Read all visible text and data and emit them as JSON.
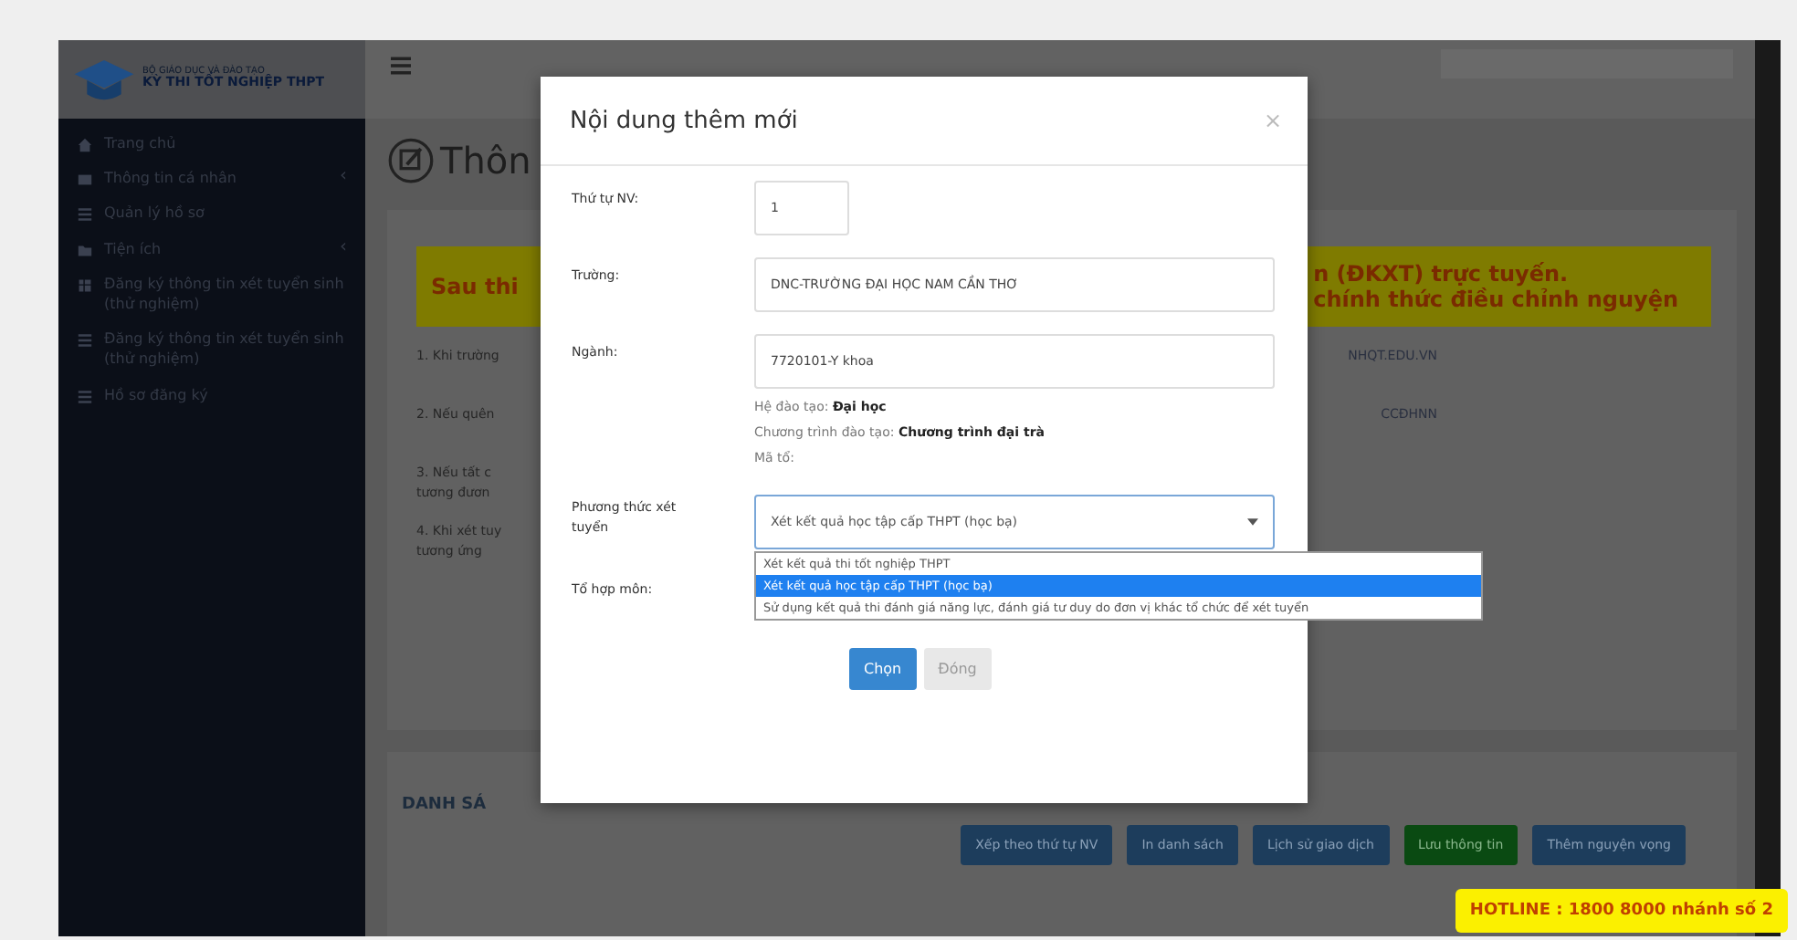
{
  "logo": {
    "line_1": "BỘ GIÁO DỤC VÀ ĐÀO TẠO",
    "line_2": "KỲ THI TỐT NGHIỆP THPT"
  },
  "sidebar": {
    "items": [
      {
        "label": "Trang chủ",
        "kind": "home"
      },
      {
        "label": "Thông tin cá nhân",
        "kind": "card",
        "caret": "‹"
      },
      {
        "label": "Quản lý hồ sơ",
        "kind": "list"
      },
      {
        "label": "Tiện ích",
        "kind": "folder",
        "caret": "‹"
      },
      {
        "label": "Đăng ký thông tin xét tuyển sinh (thử nghiệm)",
        "kind": "grid"
      },
      {
        "label": "Đăng ký thông tin xét tuyển sinh (thử nghiệm)",
        "kind": "list"
      },
      {
        "label": "Hồ sơ đăng ký",
        "kind": "list"
      }
    ]
  },
  "page": {
    "title": "Thôn",
    "banner": {
      "left": "Sau thi",
      "right_lines": [
        "n (ĐKXT) trực tuyến.",
        "chính thức điều chỉnh nguyện"
      ]
    },
    "notes": [
      {
        "left": [
          "1. Khi trường"
        ],
        "right": "NHQT.EDU.VN"
      },
      {
        "left": [
          "2. Nếu quên"
        ],
        "right": "CCĐHNN"
      },
      {
        "left": [
          "3. Nếu tất c",
          "tương đươn"
        ]
      },
      {
        "left": [
          "4. Khi xét tuy",
          "tương ứng"
        ]
      }
    ],
    "list_heading": "DANH SÁ",
    "actions": [
      {
        "label": "Xếp theo thứ tự NV",
        "kind": "primary"
      },
      {
        "label": "In danh sách",
        "kind": "primary"
      },
      {
        "label": "Lịch sử giao dịch",
        "kind": "primary"
      },
      {
        "label": "Lưu thông tin",
        "kind": "success"
      },
      {
        "label": "Thêm nguyện vọng",
        "kind": "primary"
      }
    ],
    "hotline": "HOTLINE : 1800 8000 nhánh số 2"
  },
  "modal": {
    "title": "Nội dung thêm mới",
    "close": "×",
    "order": {
      "label": "Thứ tự NV:",
      "value": "1"
    },
    "school": {
      "label": "Trường:",
      "value": "DNC-TRƯỜNG ĐẠI HỌC NAM CẦN THƠ"
    },
    "major": {
      "label": "Ngành:",
      "value": "7720101-Y khoa"
    },
    "info": [
      "Hệ đào tạo: **Đại học**",
      "Chương trình đào tạo: **Chương trình đại trà**",
      "Mã tổ:"
    ],
    "method": {
      "label": "Phương thức xét tuyển",
      "value": "Xét kết quả học tập cấp THPT (học bạ)",
      "expanded": true,
      "options": [
        {
          "label": "Xét kết quả thi tốt nghiệp THPT",
          "selected": false
        },
        {
          "label": "Xét kết quả học tập cấp THPT (học bạ)",
          "selected": true
        },
        {
          "label": "Sử dụng kết quả thi đánh giá năng lực, đánh giá tư duy do đơn vị khác tổ chức để xét tuyển",
          "selected": false
        }
      ]
    },
    "subjects": {
      "label": "Tổ hợp môn:"
    },
    "buttons": [
      {
        "label": "Chọn",
        "kind": "primary"
      },
      {
        "label": "Đóng",
        "kind": "secondary"
      }
    ]
  }
}
